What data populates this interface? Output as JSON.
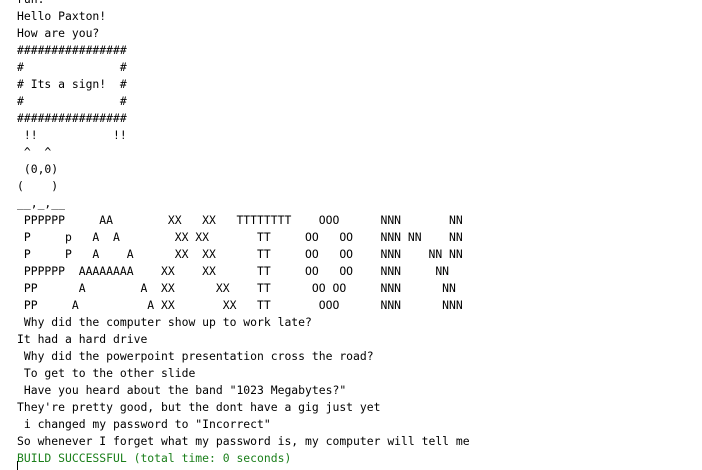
{
  "console": {
    "lines": [
      {
        "text": "run:"
      },
      {
        "text": "Hello Paxton!"
      },
      {
        "text": "How are you?"
      },
      {
        "text": "################"
      },
      {
        "text": "#              #"
      },
      {
        "text": "# Its a sign!  #"
      },
      {
        "text": "#              #"
      },
      {
        "text": "################"
      },
      {
        "text": " !!           !!"
      },
      {
        "text": " ^  ^"
      },
      {
        "text": " (0,0)"
      },
      {
        "text": "(    )"
      },
      {
        "text": "__,_,__"
      },
      {
        "text": " PPPPPP     AA        XX   XX   TTTTTTTT    OOO      NNN       NN"
      },
      {
        "text": " P     p   A  A        XX XX       TT     OO   OO    NNN NN    NN"
      },
      {
        "text": " P     P   A    A      XX  XX      TT     OO   OO    NNN    NN NN"
      },
      {
        "text": " PPPPPP  AAAAAAAA    XX    XX      TT     OO   OO    NNN     NN"
      },
      {
        "text": " PP      A        A  XX      XX    TT      OO OO     NNN      NN"
      },
      {
        "text": " PP     A          A XX       XX   TT       OOO      NNN      NNN"
      },
      {
        "text": " Why did the computer show up to work late?"
      },
      {
        "text": "It had a hard drive"
      },
      {
        "text": " Why did the powerpoint presentation cross the road?"
      },
      {
        "text": " To get to the other slide"
      },
      {
        "text": " Have you heard about the band \"1023 Megabytes?\""
      },
      {
        "text": "They're pretty good, but the dont have a gig just yet"
      },
      {
        "text": " i changed my password to \"Incorrect\""
      },
      {
        "text": "So whenever I forget what my password is, my computer will tell me"
      },
      {
        "text": "BUILD SUCCESSFUL (total time: 0 seconds)",
        "status": "success"
      }
    ],
    "colors": {
      "text": "#000000",
      "success": "#1a7f1a",
      "background": "#ffffff"
    }
  }
}
